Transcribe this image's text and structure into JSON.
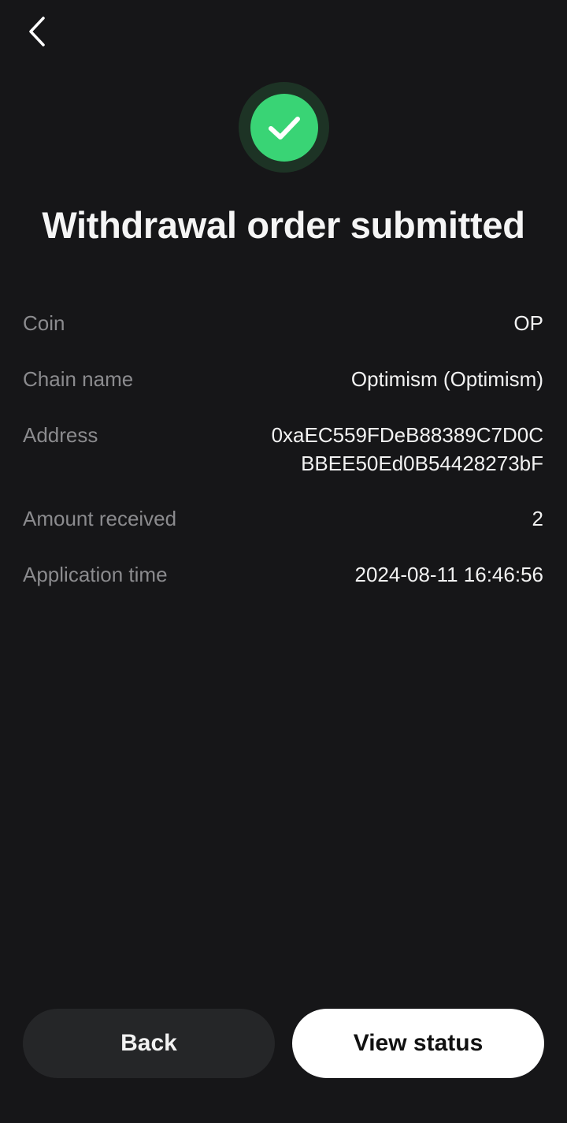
{
  "header": {
    "back_icon": "chevron-left-icon"
  },
  "status": {
    "icon": "check-circle-icon",
    "accent_color": "#39d475",
    "title": "Withdrawal order submitted"
  },
  "details": {
    "coin": {
      "label": "Coin",
      "value": "OP"
    },
    "chain": {
      "label": "Chain name",
      "value": "Optimism (Optimism)"
    },
    "address": {
      "label": "Address",
      "line1": "0xaEC559FDeB88389C7D0C",
      "line2": "BBEE50Ed0B54428273bF"
    },
    "amount": {
      "label": "Amount received",
      "value": "2"
    },
    "time": {
      "label": "Application time",
      "value": "2024-08-11 16:46:56"
    }
  },
  "actions": {
    "back_label": "Back",
    "view_status_label": "View status"
  }
}
